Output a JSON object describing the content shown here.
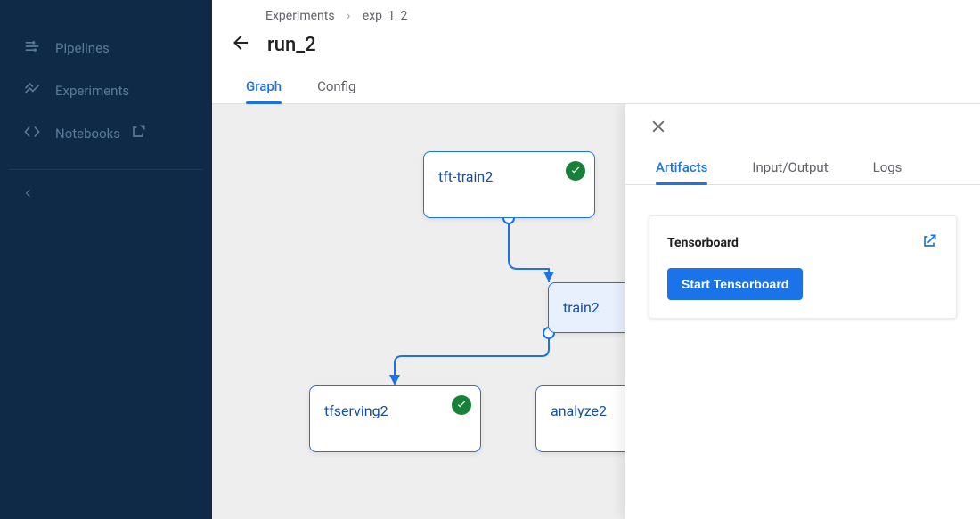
{
  "sidebar": {
    "items": [
      {
        "label": "Pipelines",
        "icon": "pipelines"
      },
      {
        "label": "Experiments",
        "icon": "experiments"
      },
      {
        "label": "Notebooks",
        "icon": "notebooks",
        "external": true
      }
    ]
  },
  "breadcrumb": {
    "items": [
      "Experiments",
      "exp_1_2"
    ]
  },
  "page": {
    "title": "run_2"
  },
  "tabs": {
    "items": [
      "Graph",
      "Config"
    ],
    "active": 0
  },
  "graph": {
    "nodes": {
      "tft_train2": {
        "label": "tft-train2",
        "status": "success"
      },
      "train2": {
        "label": "train2",
        "selected": true
      },
      "tfserving2": {
        "label": "tfserving2",
        "status": "success"
      },
      "analyze2": {
        "label": "analyze2"
      }
    }
  },
  "panel": {
    "tabs": {
      "items": [
        "Artifacts",
        "Input/Output",
        "Logs"
      ],
      "active": 0
    },
    "card": {
      "title": "Tensorboard",
      "button": "Start Tensorboard"
    }
  }
}
